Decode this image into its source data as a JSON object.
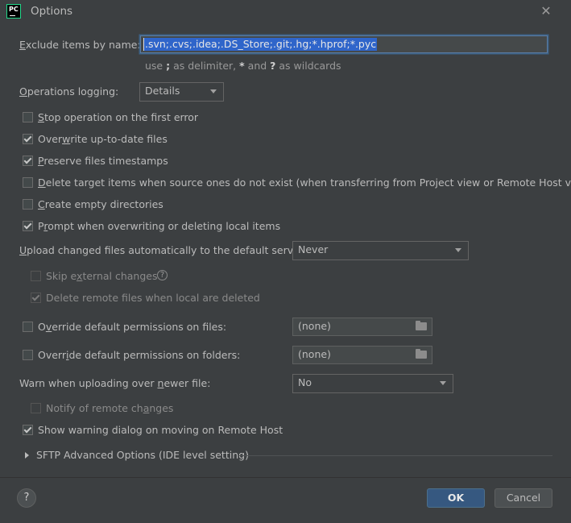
{
  "window": {
    "title": "Options",
    "logo_text": "PC"
  },
  "exclude": {
    "label_pre": "",
    "label_u": "E",
    "label_post": "xclude items by name:",
    "value": ".svn;.cvs;.idea;.DS_Store;.git;.hg;*.hprof;*.pyc",
    "hint_pre": "use ",
    "hint_b1": ";",
    "hint_mid": " as delimiter, ",
    "hint_b2": "*",
    "hint_mid2": " and ",
    "hint_b3": "?",
    "hint_post": " as wildcards"
  },
  "logging": {
    "label_u": "O",
    "label_post": "perations logging:",
    "value": "Details"
  },
  "options": [
    {
      "u": "S",
      "post": "top operation on the first error",
      "checked": false
    },
    {
      "pre": "Over",
      "u": "w",
      "post": "rite up-to-date files",
      "checked": true
    },
    {
      "u": "P",
      "post": "reserve files timestamps",
      "checked": true
    },
    {
      "u": "D",
      "post": "elete target items when source ones do not exist (when transferring from Project view or Remote Host view)",
      "checked": false
    },
    {
      "u": "C",
      "post": "reate empty directories",
      "checked": false
    },
    {
      "pre": "P",
      "u": "r",
      "post": "ompt when overwriting or deleting local items",
      "checked": true
    }
  ],
  "upload": {
    "label_u": "U",
    "label_post": "pload changed files automatically to the default server",
    "value": "Never"
  },
  "skip_external": {
    "pre": "Skip e",
    "u": "x",
    "post": "ternal changes",
    "checked": false
  },
  "delete_remote": {
    "label": "Delete remote files when local are deleted",
    "checked": true
  },
  "override_files": {
    "pre": "O",
    "u": "v",
    "post": "erride default permissions on files:",
    "value": "(none)",
    "checked": false
  },
  "override_folders": {
    "pre": "Overr",
    "u": "i",
    "post": "de default permissions on folders:",
    "value": "(none)",
    "checked": false
  },
  "warn": {
    "pre": "Warn when uploading over ",
    "u": "n",
    "post": "ewer file:",
    "value": "No"
  },
  "notify": {
    "pre": "Notify of remote ch",
    "u": "a",
    "post": "nges",
    "checked": false
  },
  "show_warning": {
    "label": "Show warning dialog on moving on Remote Host",
    "checked": true
  },
  "sftp": {
    "label": "SFTP Advanced Options (IDE level setting)"
  },
  "buttons": {
    "help": "?",
    "ok": "OK",
    "cancel": "Cancel"
  },
  "colors": {
    "background": "#3c3f41",
    "selection": "#2f65ca",
    "ok_button": "#365880",
    "focus_border": "#5a7ca3"
  }
}
